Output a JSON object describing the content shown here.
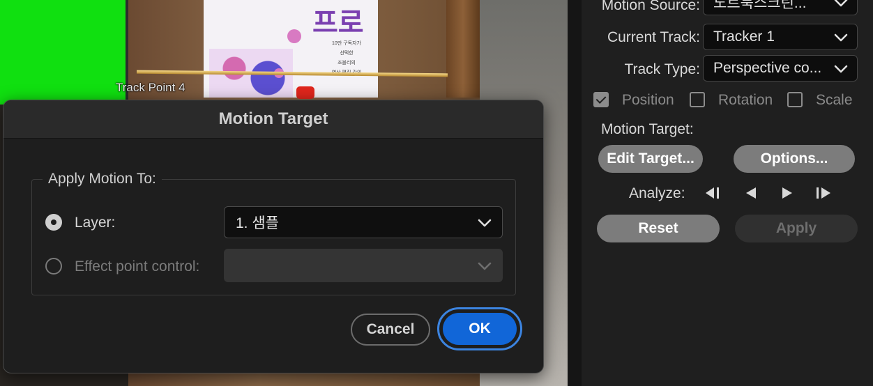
{
  "viewer": {
    "overlay_label": "Track Point 4",
    "book_title": "프로",
    "book_lines": [
      "10만 구독자가",
      "선택한",
      "조블리의",
      "영상 편집 강의"
    ]
  },
  "dialog": {
    "title": "Motion Target",
    "group_label": "Apply Motion To:",
    "options": [
      {
        "label": "Layer:",
        "selected": true,
        "enabled": true,
        "value": "1. 샘플"
      },
      {
        "label": "Effect point control:",
        "selected": false,
        "enabled": false,
        "value": ""
      }
    ],
    "cancel_label": "Cancel",
    "ok_label": "OK"
  },
  "panel": {
    "motion_source_label": "Motion Source:",
    "motion_source_value": "노트북스크린...",
    "current_track_label": "Current Track:",
    "current_track_value": "Tracker 1",
    "track_type_label": "Track Type:",
    "track_type_value": "Perspective co...",
    "checkboxes": [
      {
        "label": "Position",
        "checked": true
      },
      {
        "label": "Rotation",
        "checked": false
      },
      {
        "label": "Scale",
        "checked": false
      }
    ],
    "motion_target_label": "Motion Target:",
    "edit_target_label": "Edit Target...",
    "options_label": "Options...",
    "analyze_label": "Analyze:",
    "reset_label": "Reset",
    "apply_label": "Apply"
  },
  "colors": {
    "accent": "#1166d8",
    "focus_ring": "#3c84e0",
    "green_screen": "#10e010"
  },
  "icons": {
    "dropdown": "chevron-down-icon",
    "analyze_back_all": "step-back-all-icon",
    "analyze_back": "play-backward-icon",
    "analyze_forward": "play-forward-icon",
    "analyze_forward_all": "step-forward-all-icon"
  }
}
